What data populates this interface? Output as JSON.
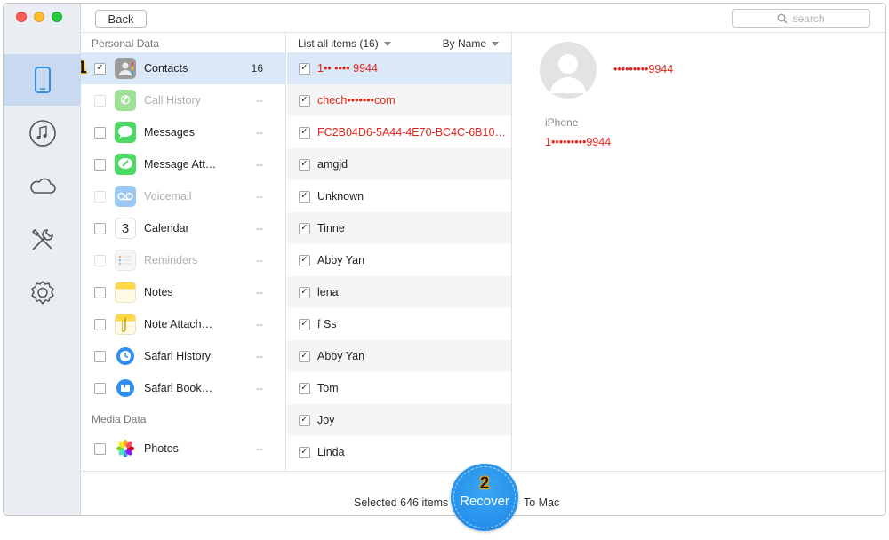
{
  "toolbar": {
    "back_label": "Back",
    "search_placeholder": "search"
  },
  "sidebar": {
    "items": [
      {
        "name": "device-icon",
        "active": true
      },
      {
        "name": "music-icon",
        "active": false
      },
      {
        "name": "cloud-icon",
        "active": false
      },
      {
        "name": "tools-icon",
        "active": false
      },
      {
        "name": "settings-icon",
        "active": false
      }
    ]
  },
  "categories": {
    "personal_header": "Personal Data",
    "media_header": "Media Data",
    "step1": "1",
    "items": [
      {
        "label": "Contacts",
        "count": "16",
        "checked": true,
        "selected": true,
        "disabled": false,
        "icon": "contacts-icon",
        "color": "#8b8b8b"
      },
      {
        "label": "Call History",
        "count": "--",
        "checked": false,
        "selected": false,
        "disabled": true,
        "icon": "phone-icon",
        "color": "#9fe097"
      },
      {
        "label": "Messages",
        "count": "--",
        "checked": false,
        "selected": false,
        "disabled": false,
        "icon": "messages-icon",
        "color": "#4cd964"
      },
      {
        "label": "Message Att…",
        "count": "--",
        "checked": false,
        "selected": false,
        "disabled": false,
        "icon": "message-attachment-icon",
        "color": "#4cd964"
      },
      {
        "label": "Voicemail",
        "count": "--",
        "checked": false,
        "selected": false,
        "disabled": true,
        "icon": "voicemail-icon",
        "color": "#9cc8f5"
      },
      {
        "label": "Calendar",
        "count": "--",
        "checked": false,
        "selected": false,
        "disabled": false,
        "icon": "calendar-icon",
        "color": "#ffffff"
      },
      {
        "label": "Reminders",
        "count": "--",
        "checked": false,
        "selected": false,
        "disabled": true,
        "icon": "reminders-icon",
        "color": "#f4f4f4"
      },
      {
        "label": "Notes",
        "count": "--",
        "checked": false,
        "selected": false,
        "disabled": false,
        "icon": "notes-icon",
        "color": "#ffd84a"
      },
      {
        "label": "Note Attach…",
        "count": "--",
        "checked": false,
        "selected": false,
        "disabled": false,
        "icon": "note-attachment-icon",
        "color": "#ffd84a"
      },
      {
        "label": "Safari History",
        "count": "--",
        "checked": false,
        "selected": false,
        "disabled": false,
        "icon": "safari-history-icon",
        "color": "#2f8ef5"
      },
      {
        "label": "Safari Book…",
        "count": "--",
        "checked": false,
        "selected": false,
        "disabled": false,
        "icon": "safari-bookmark-icon",
        "color": "#2f8ef5"
      }
    ],
    "media_items": [
      {
        "label": "Photos",
        "count": "--",
        "checked": false,
        "icon": "photos-icon"
      }
    ]
  },
  "list": {
    "header_left": "List all items (16)",
    "header_right": "By Name",
    "items": [
      {
        "text": "1•• •••• 9944",
        "red": true,
        "selected": true
      },
      {
        "text": "chech•••••••com",
        "red": true,
        "selected": false
      },
      {
        "text": "FC2B04D6-5A44-4E70-BC4C-6B100…",
        "red": true,
        "selected": false
      },
      {
        "text": "amgjd",
        "red": false,
        "selected": false
      },
      {
        "text": "Unknown",
        "red": false,
        "selected": false
      },
      {
        "text": "Tinne",
        "red": false,
        "selected": false
      },
      {
        "text": "Abby Yan",
        "red": false,
        "selected": false
      },
      {
        "text": "lena",
        "red": false,
        "selected": false
      },
      {
        "text": "f Ss",
        "red": false,
        "selected": false
      },
      {
        "text": "Abby Yan",
        "red": false,
        "selected": false
      },
      {
        "text": "Tom",
        "red": false,
        "selected": false
      },
      {
        "text": "Joy",
        "red": false,
        "selected": false
      },
      {
        "text": "Linda",
        "red": false,
        "selected": false
      }
    ]
  },
  "detail": {
    "name": "•••••••••9944",
    "phone_label": "iPhone",
    "phone": "1•••••••••9944"
  },
  "footer": {
    "selected_text": "Selected 646 items",
    "recover_label": "Recover",
    "step2": "2",
    "to_mac": "To Mac"
  },
  "colors": {
    "accent": "#1a85e4",
    "alert_red": "#e0261b",
    "selection": "#dbe8f7"
  }
}
